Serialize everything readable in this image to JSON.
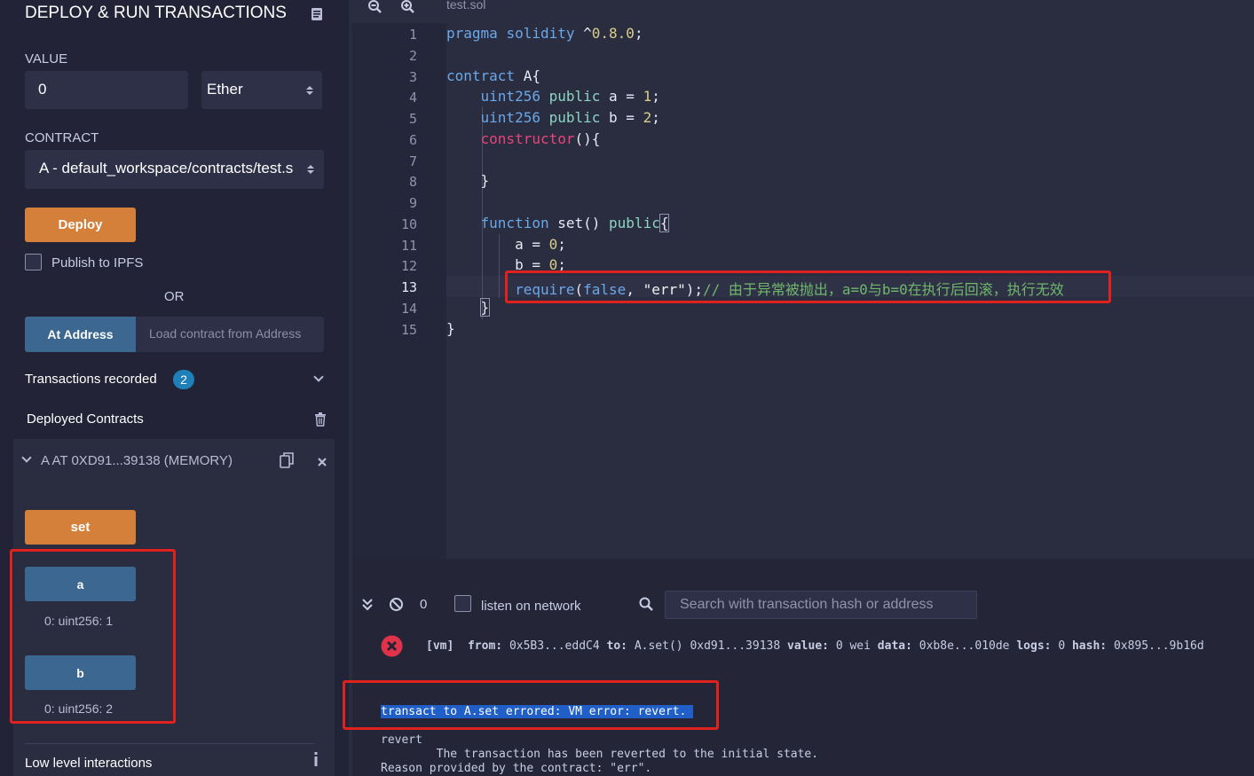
{
  "panel": {
    "title": "DEPLOY & RUN TRANSACTIONS",
    "value_label": "VALUE",
    "value": "0",
    "unit": "Ether",
    "contract_label": "CONTRACT",
    "contract_selected": "A - default_workspace/contracts/test.s",
    "deploy_label": "Deploy",
    "publish_label": "Publish to IPFS",
    "or_label": "OR",
    "at_address_label": "At Address",
    "load_placeholder": "Load contract from Address",
    "transactions_label": "Transactions recorded",
    "transactions_count": "2",
    "deployed_label": "Deployed Contracts",
    "instance_label": "A AT 0XD91...39138 (MEMORY)",
    "set_label": "set",
    "a_label": "a",
    "a_result": "0: uint256: 1",
    "b_label": "b",
    "b_result": "0: uint256: 2",
    "low_level_label": "Low level interactions"
  },
  "editor": {
    "tab_name": "test.sol",
    "line_numbers": [
      "1",
      "2",
      "3",
      "4",
      "5",
      "6",
      "7",
      "8",
      "9",
      "10",
      "11",
      "12",
      "13",
      "14",
      "15"
    ],
    "active_line": 13
  },
  "terminal": {
    "count": "0",
    "listen_label": "listen on network",
    "search_placeholder": "Search with transaction hash or address",
    "tx_tag": "[vm]",
    "from_label": "from:",
    "from_value": "0x5B3...eddC4",
    "to_label": "to:",
    "to_value": "A.set() 0xd91...39138",
    "value_label": "value:",
    "value_value": "0 wei",
    "data_label": "data:",
    "data_value": "0xb8e...010de",
    "logs_label": "logs:",
    "logs_value": "0",
    "hash_label": "hash:",
    "hash_value": "0x895...9b16d",
    "error_line": "transact to A.set errored: VM error: revert.",
    "revert_line": "revert",
    "reverted_line": "        The transaction has been reverted to the initial state.",
    "reason_line": "Reason provided by the contract: \"err\"."
  },
  "colors": {
    "accent_orange": "#d4803a",
    "accent_blue": "#3b6791",
    "highlight_red": "#e0221f",
    "error_icon": "#e0334a",
    "selection_blue": "#1f5fc7"
  }
}
